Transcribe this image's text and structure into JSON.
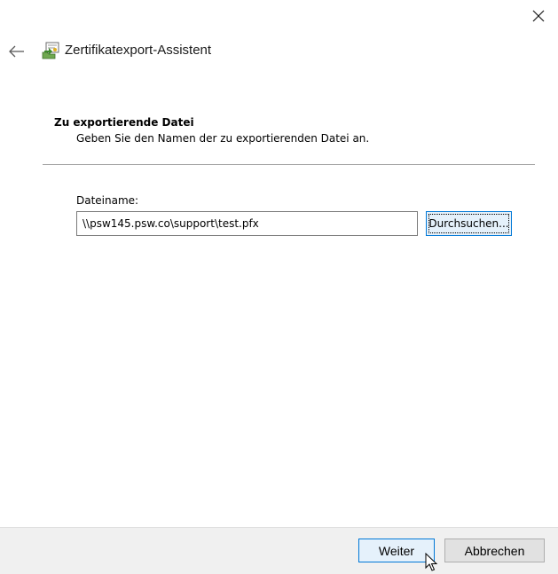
{
  "window": {
    "title": "Zertifikatexport-Assistent",
    "close_icon": "close-icon",
    "back_icon": "back-arrow-icon",
    "app_icon": "certificate-export-icon"
  },
  "page": {
    "heading": "Zu exportierende Datei",
    "subheading": "Geben Sie den Namen der zu exportierenden Datei an."
  },
  "form": {
    "filename_label": "Dateiname:",
    "filename_value": "\\\\psw145.psw.co\\support\\test.pfx",
    "browse_label": "Durchsuchen..."
  },
  "footer": {
    "next_label": "Weiter",
    "cancel_label": "Abbrechen"
  },
  "colors": {
    "accent": "#0078d7",
    "focused_button_bg": "#e5f1fb",
    "footer_bg": "#f0f0f0"
  }
}
